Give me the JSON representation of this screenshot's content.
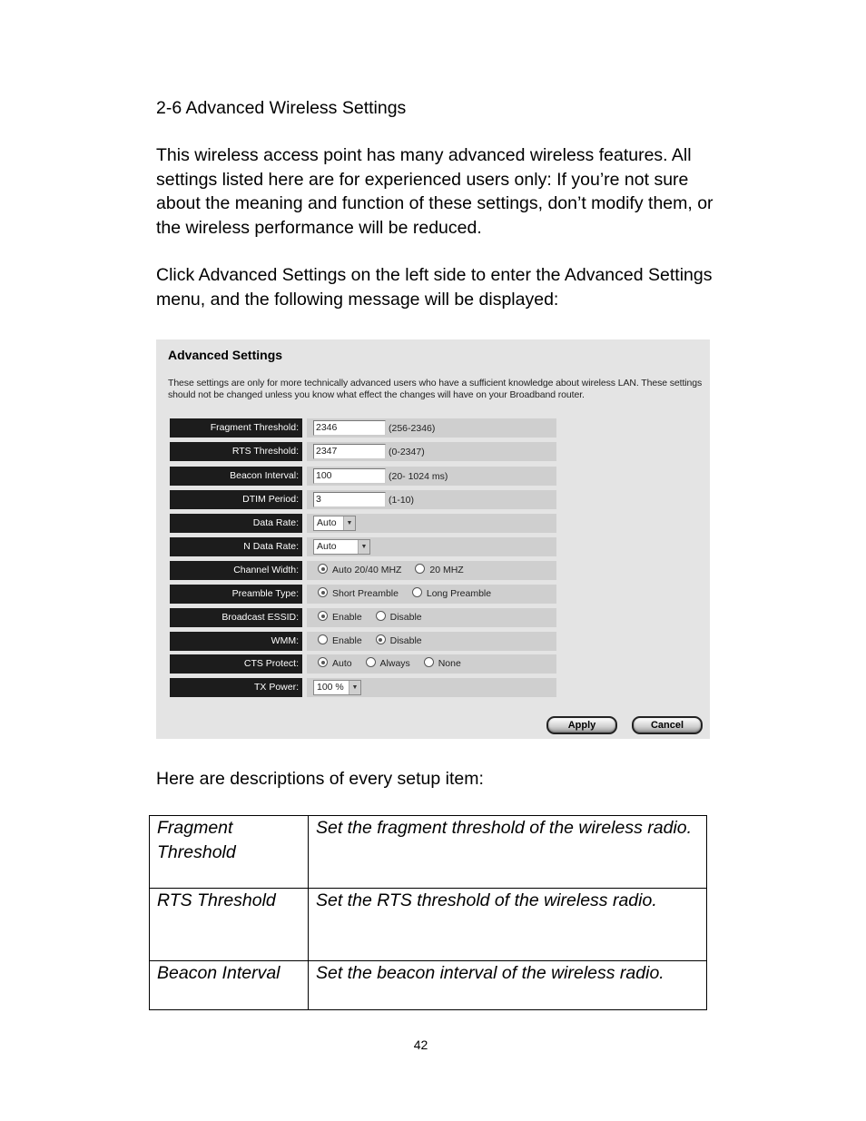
{
  "heading": "2-6 Advanced Wireless Settings",
  "intro_paragraph": "This wireless access point has many advanced wireless features. All settings listed here are for experienced users only: If you’re not sure about the meaning and function of these settings, don’t modify them, or the wireless performance will be reduced.",
  "click_paragraph": "Click Advanced Settings on the left side to enter the Advanced Settings menu, and the following message will be displayed:",
  "panel": {
    "title": "Advanced Settings",
    "description": "These settings are only for more technically advanced users who have a sufficient knowledge about wireless LAN. These settings should not be changed unless you know what effect the changes will have on your Broadband router.",
    "fields": {
      "fragment_threshold": {
        "label": "Fragment Threshold:",
        "value": "2346",
        "hint": "(256-2346)"
      },
      "rts_threshold": {
        "label": "RTS Threshold:",
        "value": "2347",
        "hint": "(0-2347)"
      },
      "beacon_interval": {
        "label": "Beacon Interval:",
        "value": "100",
        "hint": "(20- 1024 ms)"
      },
      "dtim_period": {
        "label": "DTIM Period:",
        "value": "3",
        "hint": "(1-10)"
      },
      "data_rate": {
        "label": "Data Rate:",
        "selected": "Auto"
      },
      "n_data_rate": {
        "label": "N Data Rate:",
        "selected": "Auto"
      },
      "channel_width": {
        "label": "Channel Width:",
        "options": [
          "Auto 20/40 MHZ",
          "20 MHZ"
        ],
        "selected": "Auto 20/40 MHZ"
      },
      "preamble_type": {
        "label": "Preamble Type:",
        "options": [
          "Short Preamble",
          "Long Preamble"
        ],
        "selected": "Short Preamble"
      },
      "broadcast_essid": {
        "label": "Broadcast ESSID:",
        "options": [
          "Enable",
          "Disable"
        ],
        "selected": "Enable"
      },
      "wmm": {
        "label": "WMM:",
        "options": [
          "Enable",
          "Disable"
        ],
        "selected": "Disable"
      },
      "cts_protect": {
        "label": "CTS Protect:",
        "options": [
          "Auto",
          "Always",
          "None"
        ],
        "selected": "Auto"
      },
      "tx_power": {
        "label": "TX Power:",
        "selected": "100 %"
      }
    },
    "dropdown_arrow_icon": "chevron-down",
    "apply_label": "Apply",
    "cancel_label": "Cancel"
  },
  "descriptions_intro": "Here are descriptions of every setup item:",
  "descriptions": [
    {
      "item": "Fragment Threshold",
      "description": "Set the fragment threshold of the wireless radio."
    },
    {
      "item": "RTS Threshold",
      "description": "Set the RTS threshold of the wireless radio."
    },
    {
      "item": "Beacon Interval",
      "description": "Set the beacon interval of the wireless radio."
    }
  ],
  "page_number": "42"
}
